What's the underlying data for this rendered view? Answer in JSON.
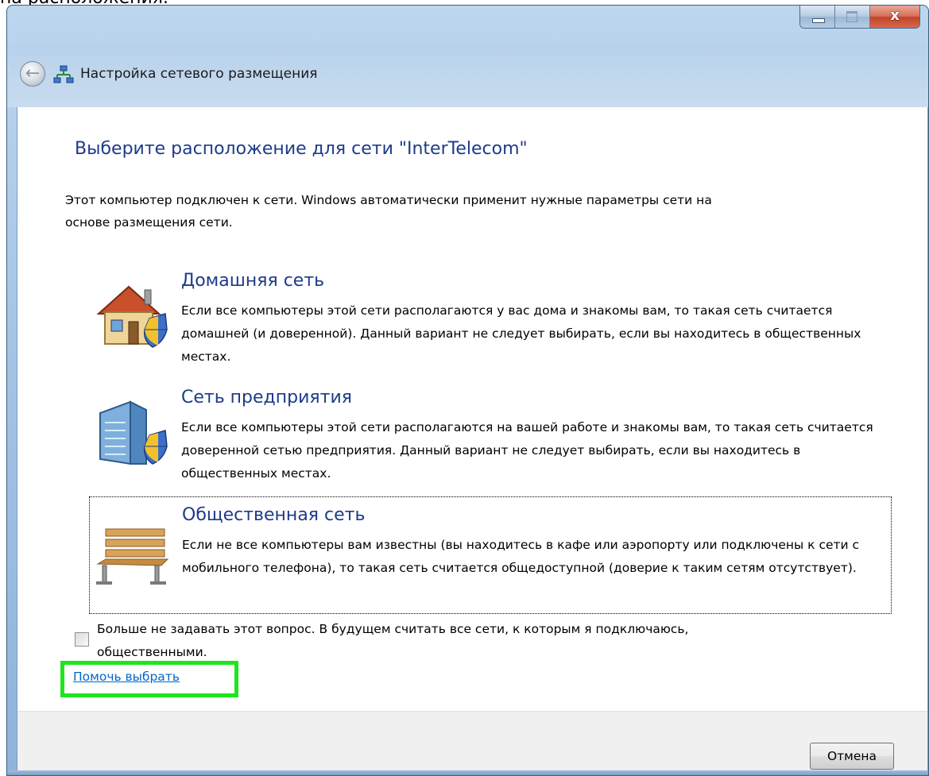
{
  "page_caption": "на расположения.",
  "window": {
    "title": "Настройка сетевого размещения",
    "controls": {
      "close_glyph": "x"
    }
  },
  "nav": {
    "back_glyph": "←"
  },
  "heading": "Выберите расположение для сети \"InterTelecom\"",
  "intro": "Этот компьютер подключен к сети. Windows автоматически применит нужные параметры сети на основе размещения сети.",
  "options": [
    {
      "title": "Домашняя сеть",
      "description": "Если все компьютеры этой сети располагаются у вас дома и знакомы вам, то такая сеть считается домашней (и доверенной). Данный вариант не следует выбирать, если вы находитесь в общественных местах.",
      "icon": "house-shield-icon"
    },
    {
      "title": "Сеть предприятия",
      "description": "Если все компьютеры этой сети располагаются на вашей работе и знакомы вам, то такая сеть считается доверенной сетью предприятия. Данный вариант не следует выбирать, если вы находитесь в общественных местах.",
      "icon": "office-building-shield-icon"
    },
    {
      "title": "Общественная сеть",
      "description": "Если не все компьютеры вам известны (вы находитесь в кафе или аэропорту или подключены к сети с мобильного телефона), то такая сеть считается общедоступной (доверие к таким сетям отсутствует).",
      "icon": "park-bench-icon"
    }
  ],
  "checkbox": {
    "label": "Больше не задавать этот вопрос. В будущем считать все сети, к которым я подключаюсь, общественными.",
    "checked": false
  },
  "help_link": "Помочь выбрать",
  "cancel_button": "Отмена",
  "colors": {
    "heading": "#1e3b8a",
    "link": "#0066cc",
    "highlight": "#1ee51e"
  }
}
